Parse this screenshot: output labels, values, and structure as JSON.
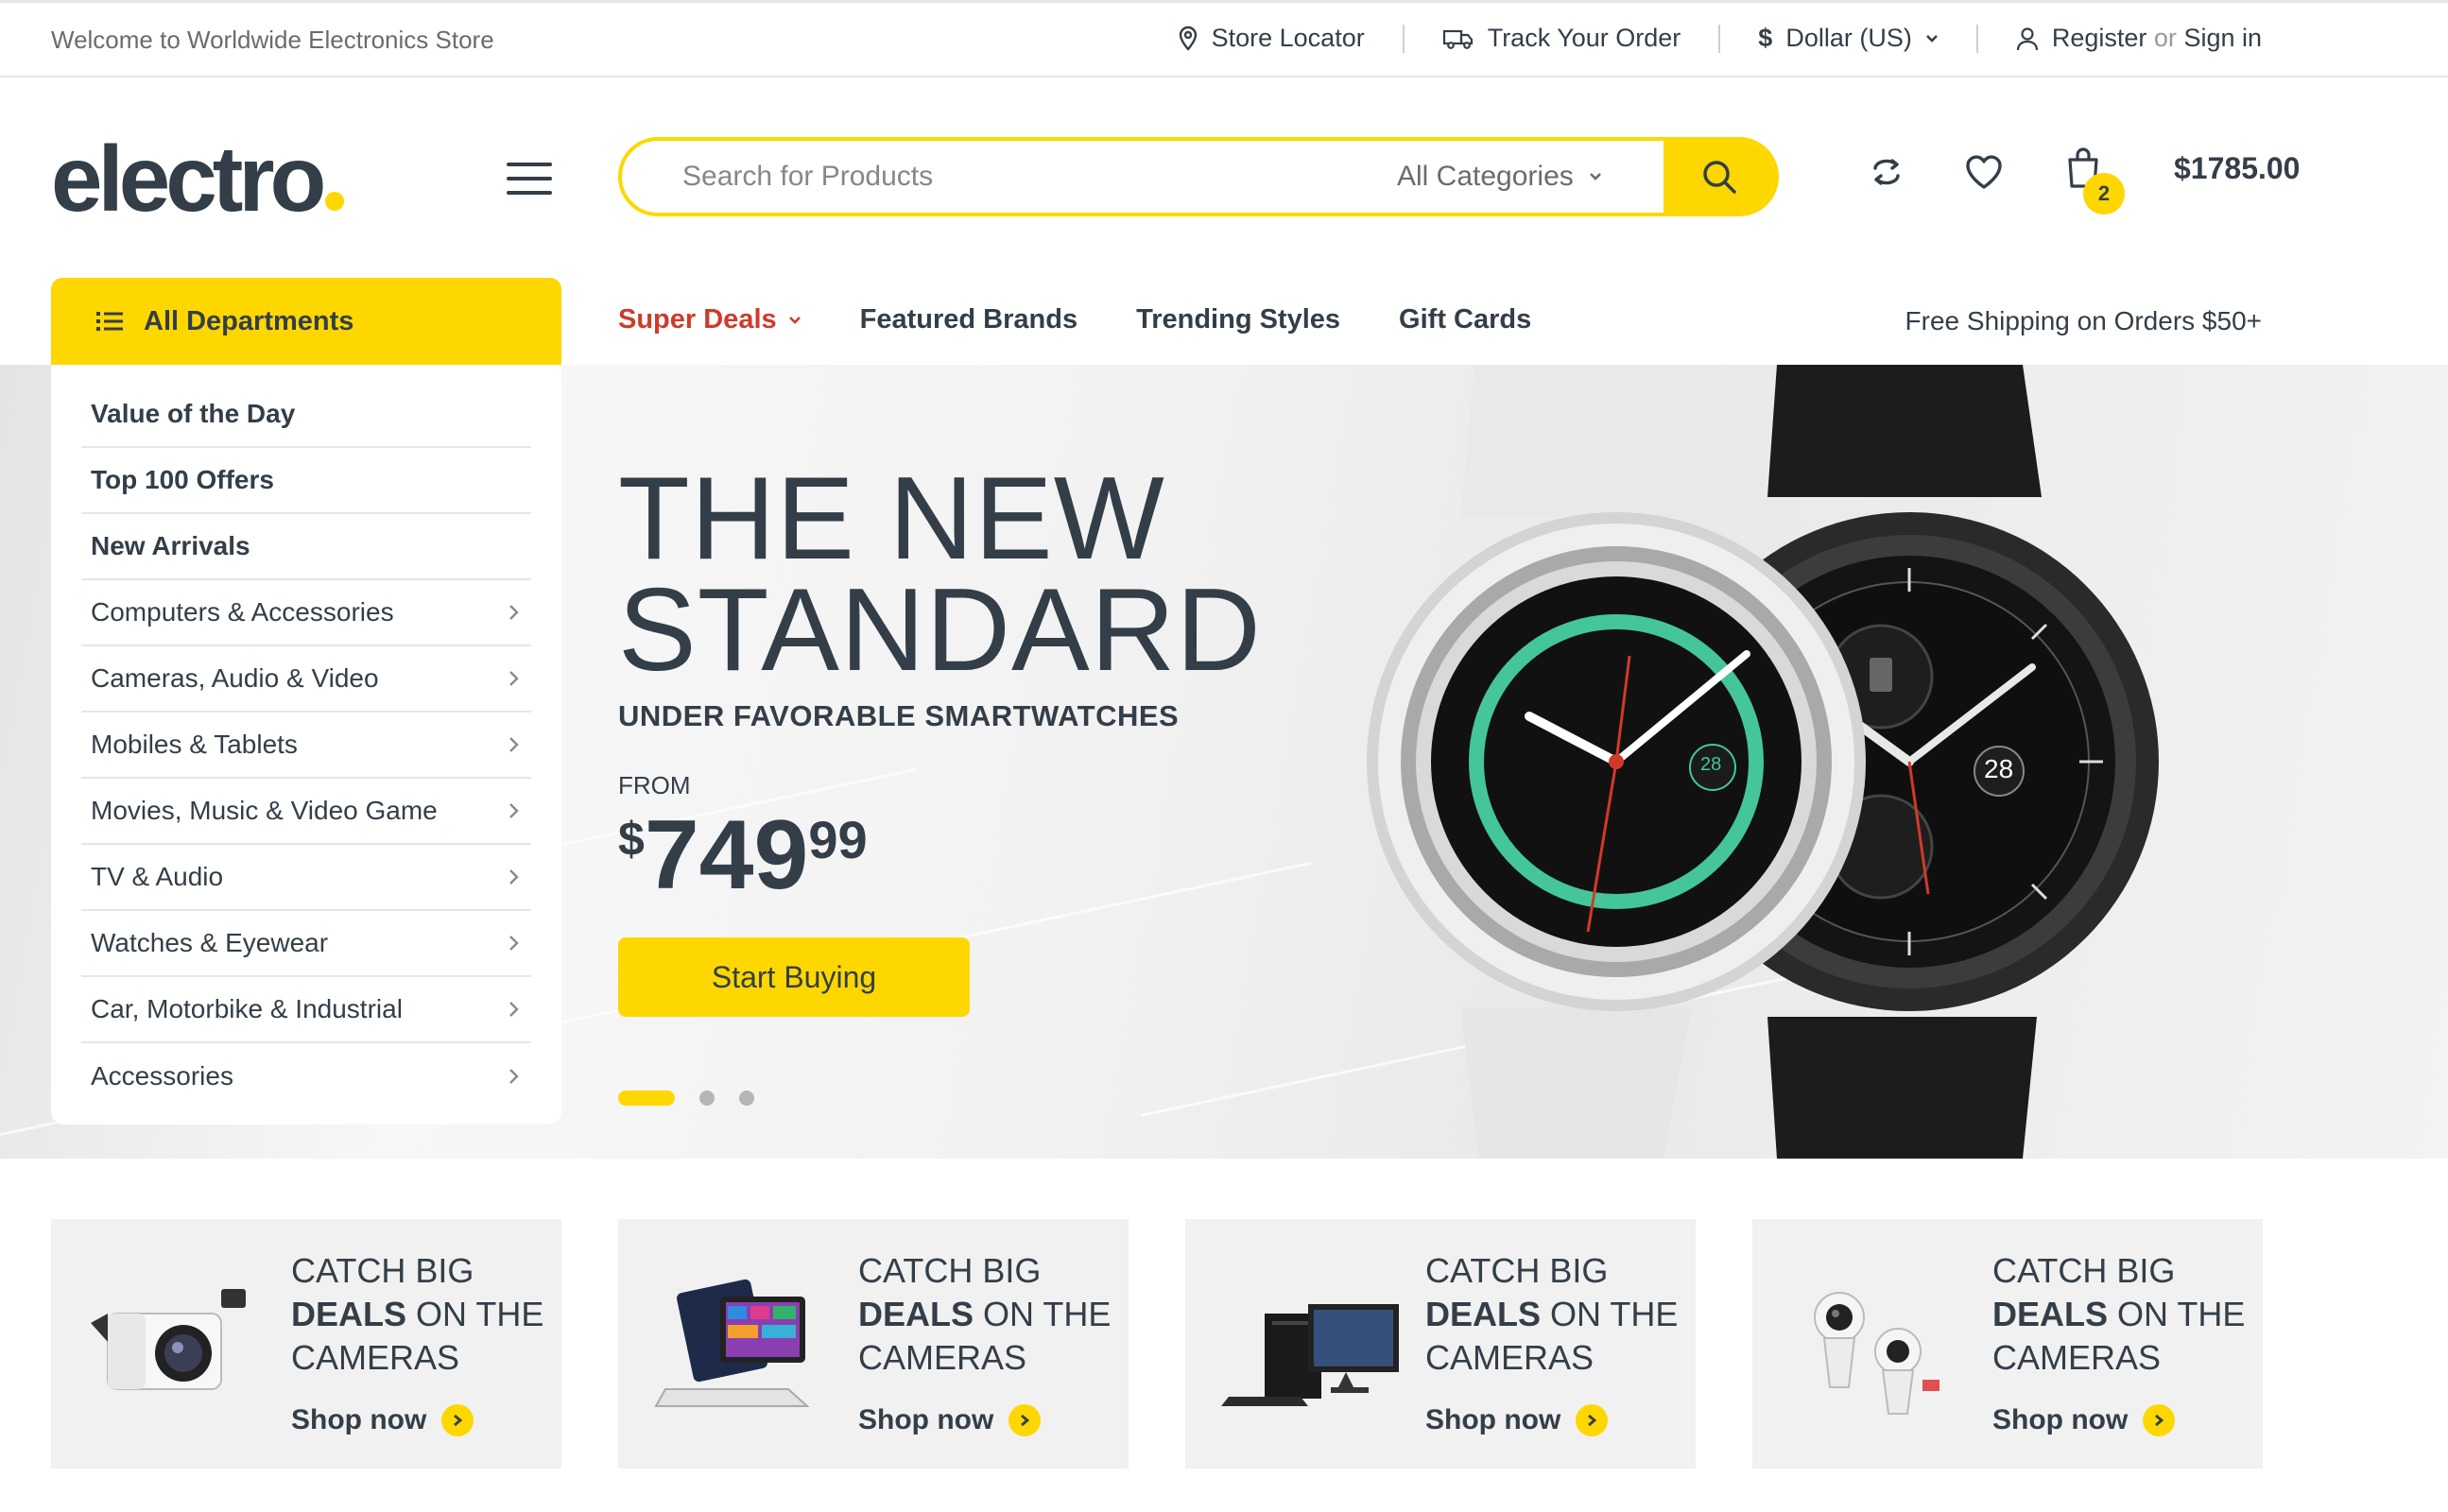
{
  "topbar": {
    "welcome": "Welcome to Worldwide Electronics Store",
    "store_locator": "Store Locator",
    "track_order": "Track Your Order",
    "currency": "Dollar (US)",
    "currency_symbol": "$",
    "register": "Register",
    "or": "or",
    "sign_in": "Sign in"
  },
  "header": {
    "logo": "electro",
    "search_placeholder": "Search for Products",
    "category_select": "All Categories",
    "cart_count": "2",
    "cart_total": "$1785.00"
  },
  "nav": {
    "departments_label": "All Departments",
    "items": [
      {
        "label": "Super Deals",
        "highlight": true
      },
      {
        "label": "Featured Brands"
      },
      {
        "label": "Trending Styles"
      },
      {
        "label": "Gift Cards"
      }
    ],
    "shipping_note": "Free Shipping on Orders $50+"
  },
  "departments": [
    {
      "label": "Value of the Day",
      "bold": true
    },
    {
      "label": "Top 100 Offers",
      "bold": true
    },
    {
      "label": "New Arrivals",
      "bold": true
    },
    {
      "label": "Computers & Accessories",
      "arrow": true
    },
    {
      "label": "Cameras, Audio & Video",
      "arrow": true
    },
    {
      "label": "Mobiles & Tablets",
      "arrow": true
    },
    {
      "label": "Movies, Music & Video Game",
      "arrow": true
    },
    {
      "label": "TV & Audio",
      "arrow": true
    },
    {
      "label": "Watches & Eyewear",
      "arrow": true
    },
    {
      "label": "Car, Motorbike & Industrial",
      "arrow": true
    },
    {
      "label": "Accessories",
      "arrow": true
    }
  ],
  "hero": {
    "title_line1": "THE NEW",
    "title_line2": "STANDARD",
    "subtitle": "UNDER FAVORABLE SMARTWATCHES",
    "from": "FROM",
    "price_currency": "$",
    "price_int": "749",
    "price_cents": "99",
    "cta": "Start Buying",
    "slides_total": 3,
    "active_slide": 1,
    "watch_date": "28"
  },
  "promos": [
    {
      "line1": "CATCH BIG",
      "bold": "DEALS",
      "line2_rest": " ON THE",
      "line3": "CAMERAS",
      "cta": "Shop now",
      "image": "camera"
    },
    {
      "line1": "CATCH BIG",
      "bold": "DEALS",
      "line2_rest": " ON THE",
      "line3": "CAMERAS",
      "cta": "Shop now",
      "image": "laptop-tablet"
    },
    {
      "line1": "CATCH BIG",
      "bold": "DEALS",
      "line2_rest": " ON THE",
      "line3": "CAMERAS",
      "cta": "Shop now",
      "image": "desktop-pc"
    },
    {
      "line1": "CATCH BIG",
      "bold": "DEALS",
      "line2_rest": " ON THE",
      "line3": "CAMERAS",
      "cta": "Shop now",
      "image": "360-camera"
    }
  ],
  "colors": {
    "accent": "#fed700",
    "text": "#333e48",
    "hot": "#d03a2b"
  }
}
